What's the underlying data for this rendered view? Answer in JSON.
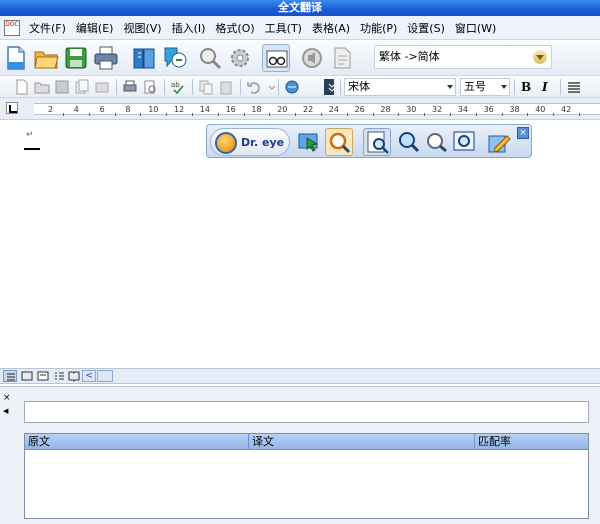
{
  "window": {
    "title": "全文翻译"
  },
  "menu": {
    "items": [
      "文件(F)",
      "编辑(E)",
      "视图(V)",
      "插入(I)",
      "格式(O)",
      "工具(T)",
      "表格(A)",
      "功能(P)",
      "设置(S)",
      "窗口(W)"
    ]
  },
  "toolbar": {
    "language_direction": "繁体 ->简体"
  },
  "format_bar": {
    "font_name": "宋体",
    "font_size": "五号",
    "bold_label": "B",
    "italic_label": "I"
  },
  "ruler": {
    "numbers": [
      "2",
      "4",
      "6",
      "8",
      "10",
      "12",
      "14",
      "16",
      "18",
      "20",
      "22",
      "24",
      "26",
      "28",
      "30",
      "32",
      "34",
      "36",
      "38",
      "40",
      "42"
    ]
  },
  "dreye": {
    "brand": "Dr. eye",
    "close_label": "×"
  },
  "bottom_panel": {
    "close_label": "×",
    "pin_label": "◀",
    "input_value": "",
    "columns": [
      "原文",
      "译文",
      "匹配率"
    ]
  },
  "colors": {
    "title_bar": "#1a5cd6",
    "header_row": "#a9c6ef"
  }
}
